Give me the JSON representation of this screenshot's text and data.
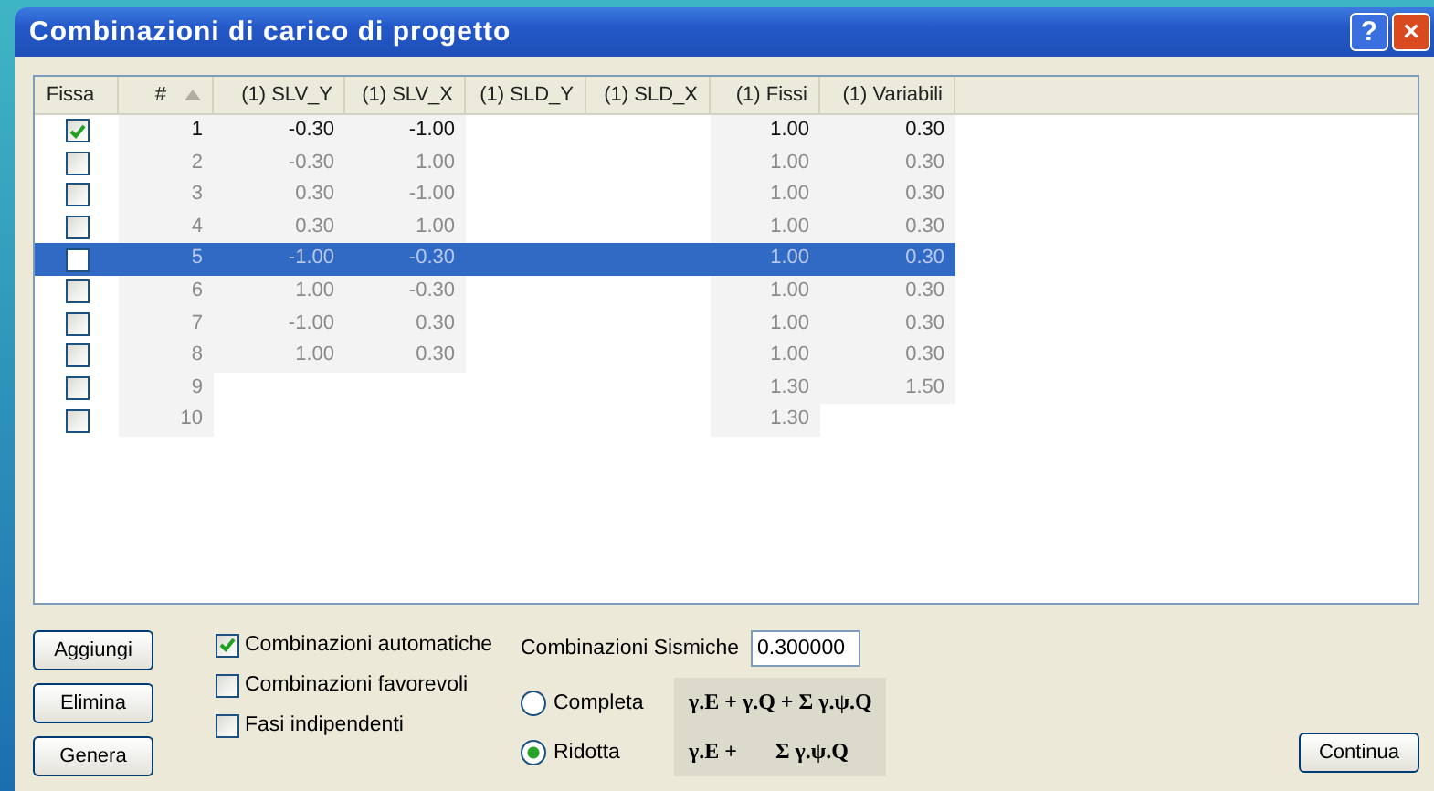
{
  "window": {
    "title": "Combinazioni di carico di progetto",
    "help_button": "?",
    "close_button": "×"
  },
  "table": {
    "columns": [
      {
        "label": "Fissa",
        "sorted": false
      },
      {
        "label": "#",
        "sorted": true
      },
      {
        "label": "(1) SLV_Y",
        "sorted": false
      },
      {
        "label": "(1) SLV_X",
        "sorted": false
      },
      {
        "label": "(1) SLD_Y",
        "sorted": false
      },
      {
        "label": "(1) SLD_X",
        "sorted": false
      },
      {
        "label": "(1) Fissi",
        "sorted": false
      },
      {
        "label": "(1) Variabili",
        "sorted": false
      }
    ],
    "rows": [
      {
        "checked": true,
        "selected": false,
        "cells": [
          "",
          "1",
          "-0.30",
          "-1.00",
          "",
          "",
          "1.00",
          "0.30"
        ]
      },
      {
        "checked": false,
        "selected": false,
        "cells": [
          "",
          "2",
          "-0.30",
          "1.00",
          "",
          "",
          "1.00",
          "0.30"
        ]
      },
      {
        "checked": false,
        "selected": false,
        "cells": [
          "",
          "3",
          "0.30",
          "-1.00",
          "",
          "",
          "1.00",
          "0.30"
        ]
      },
      {
        "checked": false,
        "selected": false,
        "cells": [
          "",
          "4",
          "0.30",
          "1.00",
          "",
          "",
          "1.00",
          "0.30"
        ]
      },
      {
        "checked": false,
        "selected": true,
        "cells": [
          "",
          "5",
          "-1.00",
          "-0.30",
          "",
          "",
          "1.00",
          "0.30"
        ]
      },
      {
        "checked": false,
        "selected": false,
        "cells": [
          "",
          "6",
          "1.00",
          "-0.30",
          "",
          "",
          "1.00",
          "0.30"
        ]
      },
      {
        "checked": false,
        "selected": false,
        "cells": [
          "",
          "7",
          "-1.00",
          "0.30",
          "",
          "",
          "1.00",
          "0.30"
        ]
      },
      {
        "checked": false,
        "selected": false,
        "cells": [
          "",
          "8",
          "1.00",
          "0.30",
          "",
          "",
          "1.00",
          "0.30"
        ]
      },
      {
        "checked": false,
        "selected": false,
        "cells": [
          "",
          "9",
          "",
          "",
          "",
          "",
          "1.30",
          "1.50"
        ]
      },
      {
        "checked": false,
        "selected": false,
        "cells": [
          "",
          "10",
          "",
          "",
          "",
          "",
          "1.30",
          ""
        ]
      }
    ]
  },
  "buttons": [
    "Aggiungi",
    "Elimina",
    "Genera"
  ],
  "options": [
    {
      "label": "Combinazioni automatiche",
      "checked": true
    },
    {
      "label": "Combinazioni favorevoli",
      "checked": false
    },
    {
      "label": "Fasi indipendenti",
      "checked": false
    }
  ],
  "seismic": {
    "label": "Combinazioni Sismiche",
    "value": "0.300000",
    "modes": [
      {
        "label": "Completa",
        "selected": false,
        "formula": "γ.E + γ.Q + Σ γ.ψ.Q"
      },
      {
        "label": "Ridotta",
        "selected": true,
        "formula": "γ.E +       Σ γ.ψ.Q"
      }
    ]
  },
  "continue_button": "Continua"
}
